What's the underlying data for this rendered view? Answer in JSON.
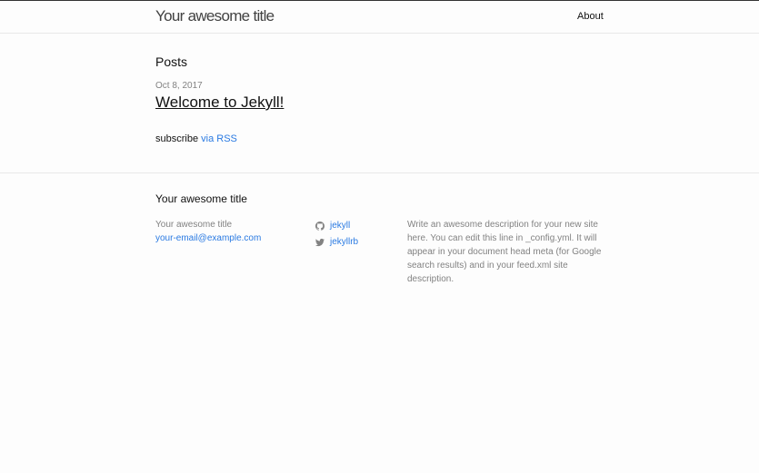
{
  "header": {
    "site_title": "Your awesome title",
    "nav": [
      "About"
    ]
  },
  "main": {
    "posts_heading": "Posts",
    "posts": [
      {
        "date": "Oct 8, 2017",
        "title": "Welcome to Jekyll!"
      }
    ],
    "rss": {
      "prefix": "subscribe ",
      "link_label": "via RSS"
    }
  },
  "footer": {
    "heading": "Your awesome title",
    "contact": {
      "name": "Your awesome title",
      "email": "your-email@example.com"
    },
    "social": [
      {
        "icon": "github-icon",
        "label": "jekyll"
      },
      {
        "icon": "twitter-icon",
        "label": "jekyllrb"
      }
    ],
    "description": "Write an awesome description for your new site here. You can edit this line in _config.yml. It will appear in your document head meta (for Google search results) and in your feed.xml site description."
  },
  "colors": {
    "link": "#2a7ae2",
    "muted": "#828282",
    "text": "#111111",
    "background": "#fdfdfd",
    "border": "#e8e8e8"
  }
}
